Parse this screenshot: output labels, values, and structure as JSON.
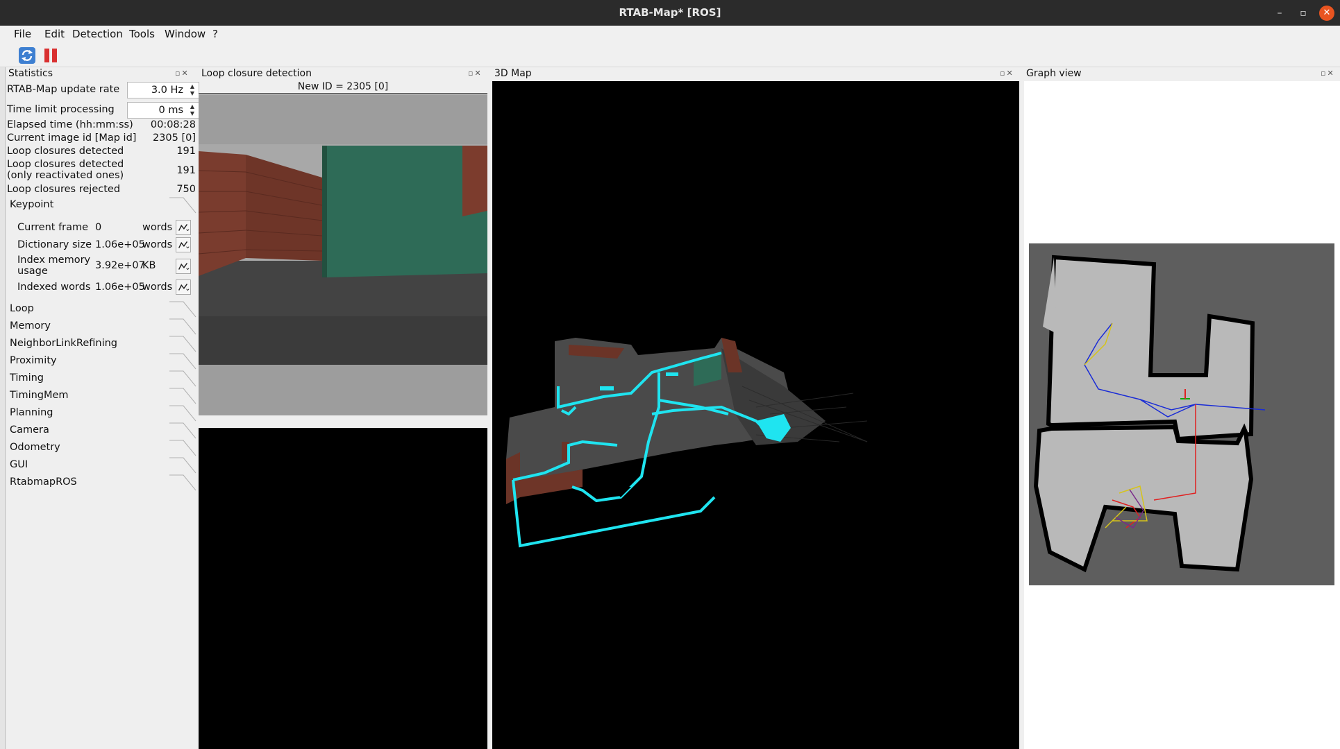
{
  "window": {
    "title": "RTAB-Map* [ROS]",
    "controls": {
      "minimize": "–",
      "restore": "▫",
      "close": "✕"
    }
  },
  "menu": [
    "File",
    "Edit",
    "Detection",
    "Tools",
    "Window",
    "?"
  ],
  "toolbar": {
    "icons": [
      "refresh-icon",
      "pause-icon"
    ]
  },
  "panels": {
    "statistics": "Statistics",
    "loop": "Loop closure detection",
    "map3d": "3D Map",
    "graph": "Graph view",
    "dock_buttons": "▫✕"
  },
  "stats": {
    "update_rate_label": "RTAB-Map update rate",
    "update_rate_value": "3.0 Hz",
    "time_limit_label": "Time limit processing",
    "time_limit_value": "0 ms",
    "elapsed_label": "Elapsed time (hh:mm:ss)",
    "elapsed_value": "00:08:28",
    "image_id_label": "Current image id [Map id]",
    "image_id_value": "2305 [0]",
    "loop_detected_label": "Loop closures detected",
    "loop_detected_value": "191",
    "loop_reactivated_label1": "Loop closures detected",
    "loop_reactivated_label2": "(only reactivated ones)",
    "loop_reactivated_value": "191",
    "loop_rejected_label": "Loop closures rejected",
    "loop_rejected_value": "750"
  },
  "keypoint": {
    "title": "Keypoint",
    "rows": [
      {
        "label": "Current frame",
        "value": "0",
        "unit": "words"
      },
      {
        "label": "Dictionary size",
        "value": "1.06e+05",
        "unit": "words"
      },
      {
        "label1": "Index memory",
        "label2": "usage",
        "value": "3.92e+07",
        "unit": "KB"
      },
      {
        "label": "Indexed words",
        "value": "1.06e+05",
        "unit": "words"
      }
    ]
  },
  "sections": [
    "Loop",
    "Memory",
    "NeighborLinkRefining",
    "Proximity",
    "Timing",
    "TimingMem",
    "Planning",
    "Camera",
    "Odometry",
    "GUI",
    "RtabmapROS"
  ],
  "loop_closure": {
    "new_id": "New ID = 2305 [0]"
  },
  "colors": {
    "titlebar": "#2b2b2b",
    "close_accent": "#e95420",
    "trajectory_3d": "#1fe4f0",
    "graph_background": "#5e5e5e",
    "graph_free": "#b9b9b9"
  }
}
